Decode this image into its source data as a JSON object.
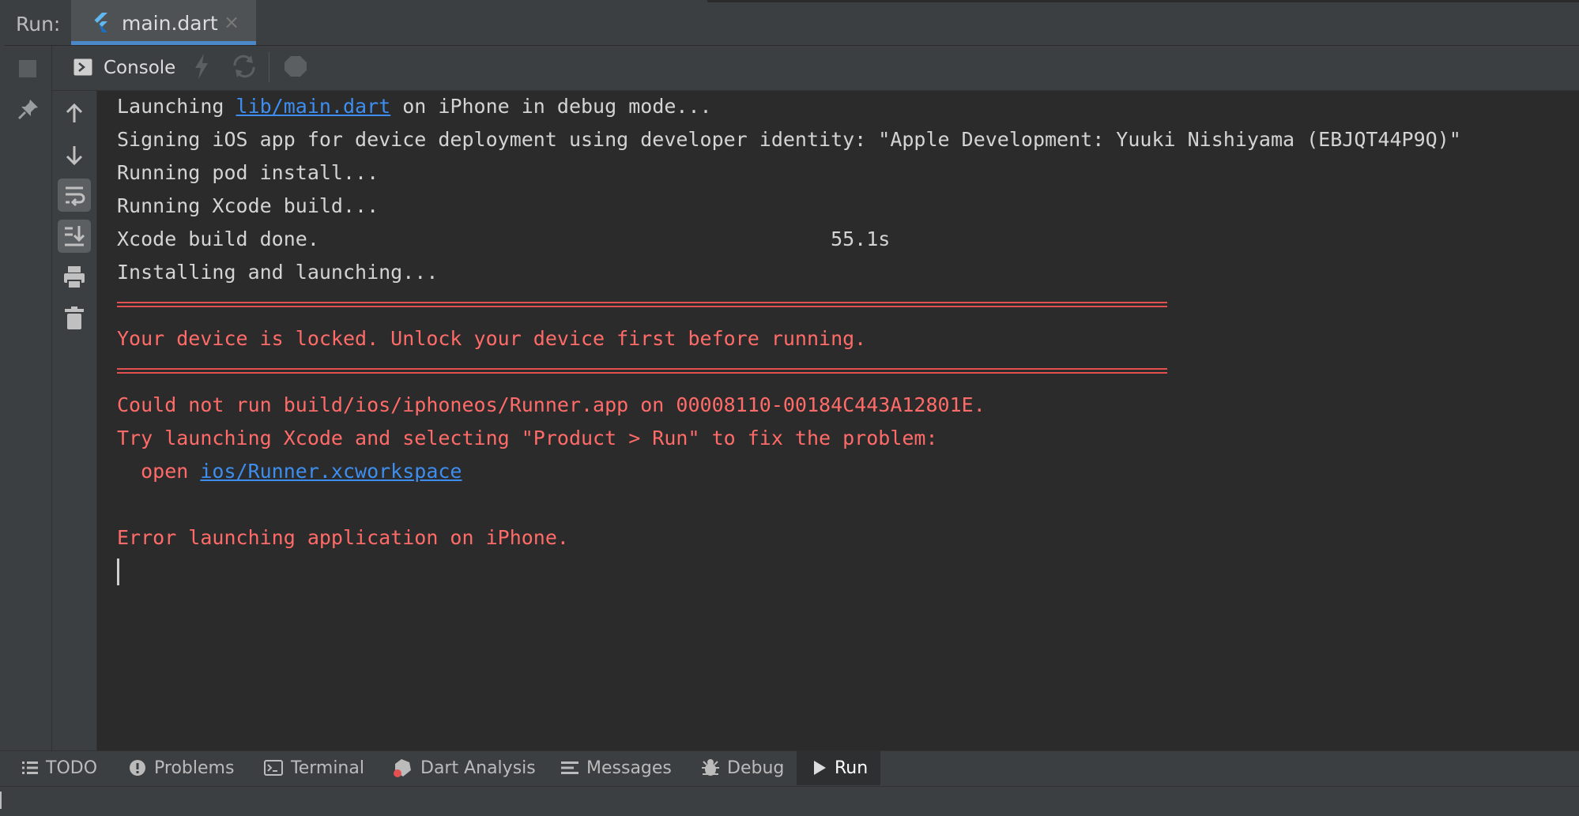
{
  "run_panel": {
    "label": "Run:",
    "tab": {
      "title": "main.dart",
      "close": "×",
      "icon": "flutter-icon"
    }
  },
  "toolbar": {
    "console_label": "Console",
    "icons": [
      "console-icon",
      "bolt-icon",
      "reload-icon",
      "devtools-icon"
    ]
  },
  "gutter": {
    "icons": [
      "stop-icon",
      "pin-icon",
      "up-arrow-icon",
      "down-arrow-icon",
      "soft-wrap-icon",
      "scroll-to-end-icon",
      "print-icon",
      "trash-icon"
    ]
  },
  "console": {
    "l1_pre": "Launching ",
    "l1_link": "lib/main.dart",
    "l1_post": " on iPhone in debug mode...",
    "l2": "Signing iOS app for device deployment using developer identity: \"Apple Development: Yuuki Nishiyama (EBJQT44P9Q)\"",
    "l3": "Running pod install...",
    "l4": "Running Xcode build...",
    "l5": "Xcode build done.                                           55.1s",
    "l6": "Installing and launching...",
    "e1": "Your device is locked. Unlock your device first before running.",
    "e2": "Could not run build/ios/iphoneos/Runner.app on 00008110-00184C443A12801E.",
    "e3": "Try launching Xcode and selecting \"Product > Run\" to fix the problem:",
    "e4_pre": "  open ",
    "e4_link": "ios/Runner.xcworkspace",
    "e5": "Error launching application on iPhone."
  },
  "bottom_tabs": [
    {
      "label": "TODO",
      "icon": "list-icon"
    },
    {
      "label": "Problems",
      "icon": "problems-icon"
    },
    {
      "label": "Terminal",
      "icon": "terminal-icon"
    },
    {
      "label": "Dart Analysis",
      "icon": "dart-analysis-icon"
    },
    {
      "label": "Messages",
      "icon": "messages-icon"
    },
    {
      "label": "Debug",
      "icon": "debug-icon"
    },
    {
      "label": "Run",
      "icon": "run-icon"
    }
  ],
  "colors": {
    "background": "#2b2b2b",
    "panel": "#3c3f41",
    "error_text": "#ff6b68",
    "link": "#3d8ef0",
    "tab_underline": "#4a88c7"
  }
}
